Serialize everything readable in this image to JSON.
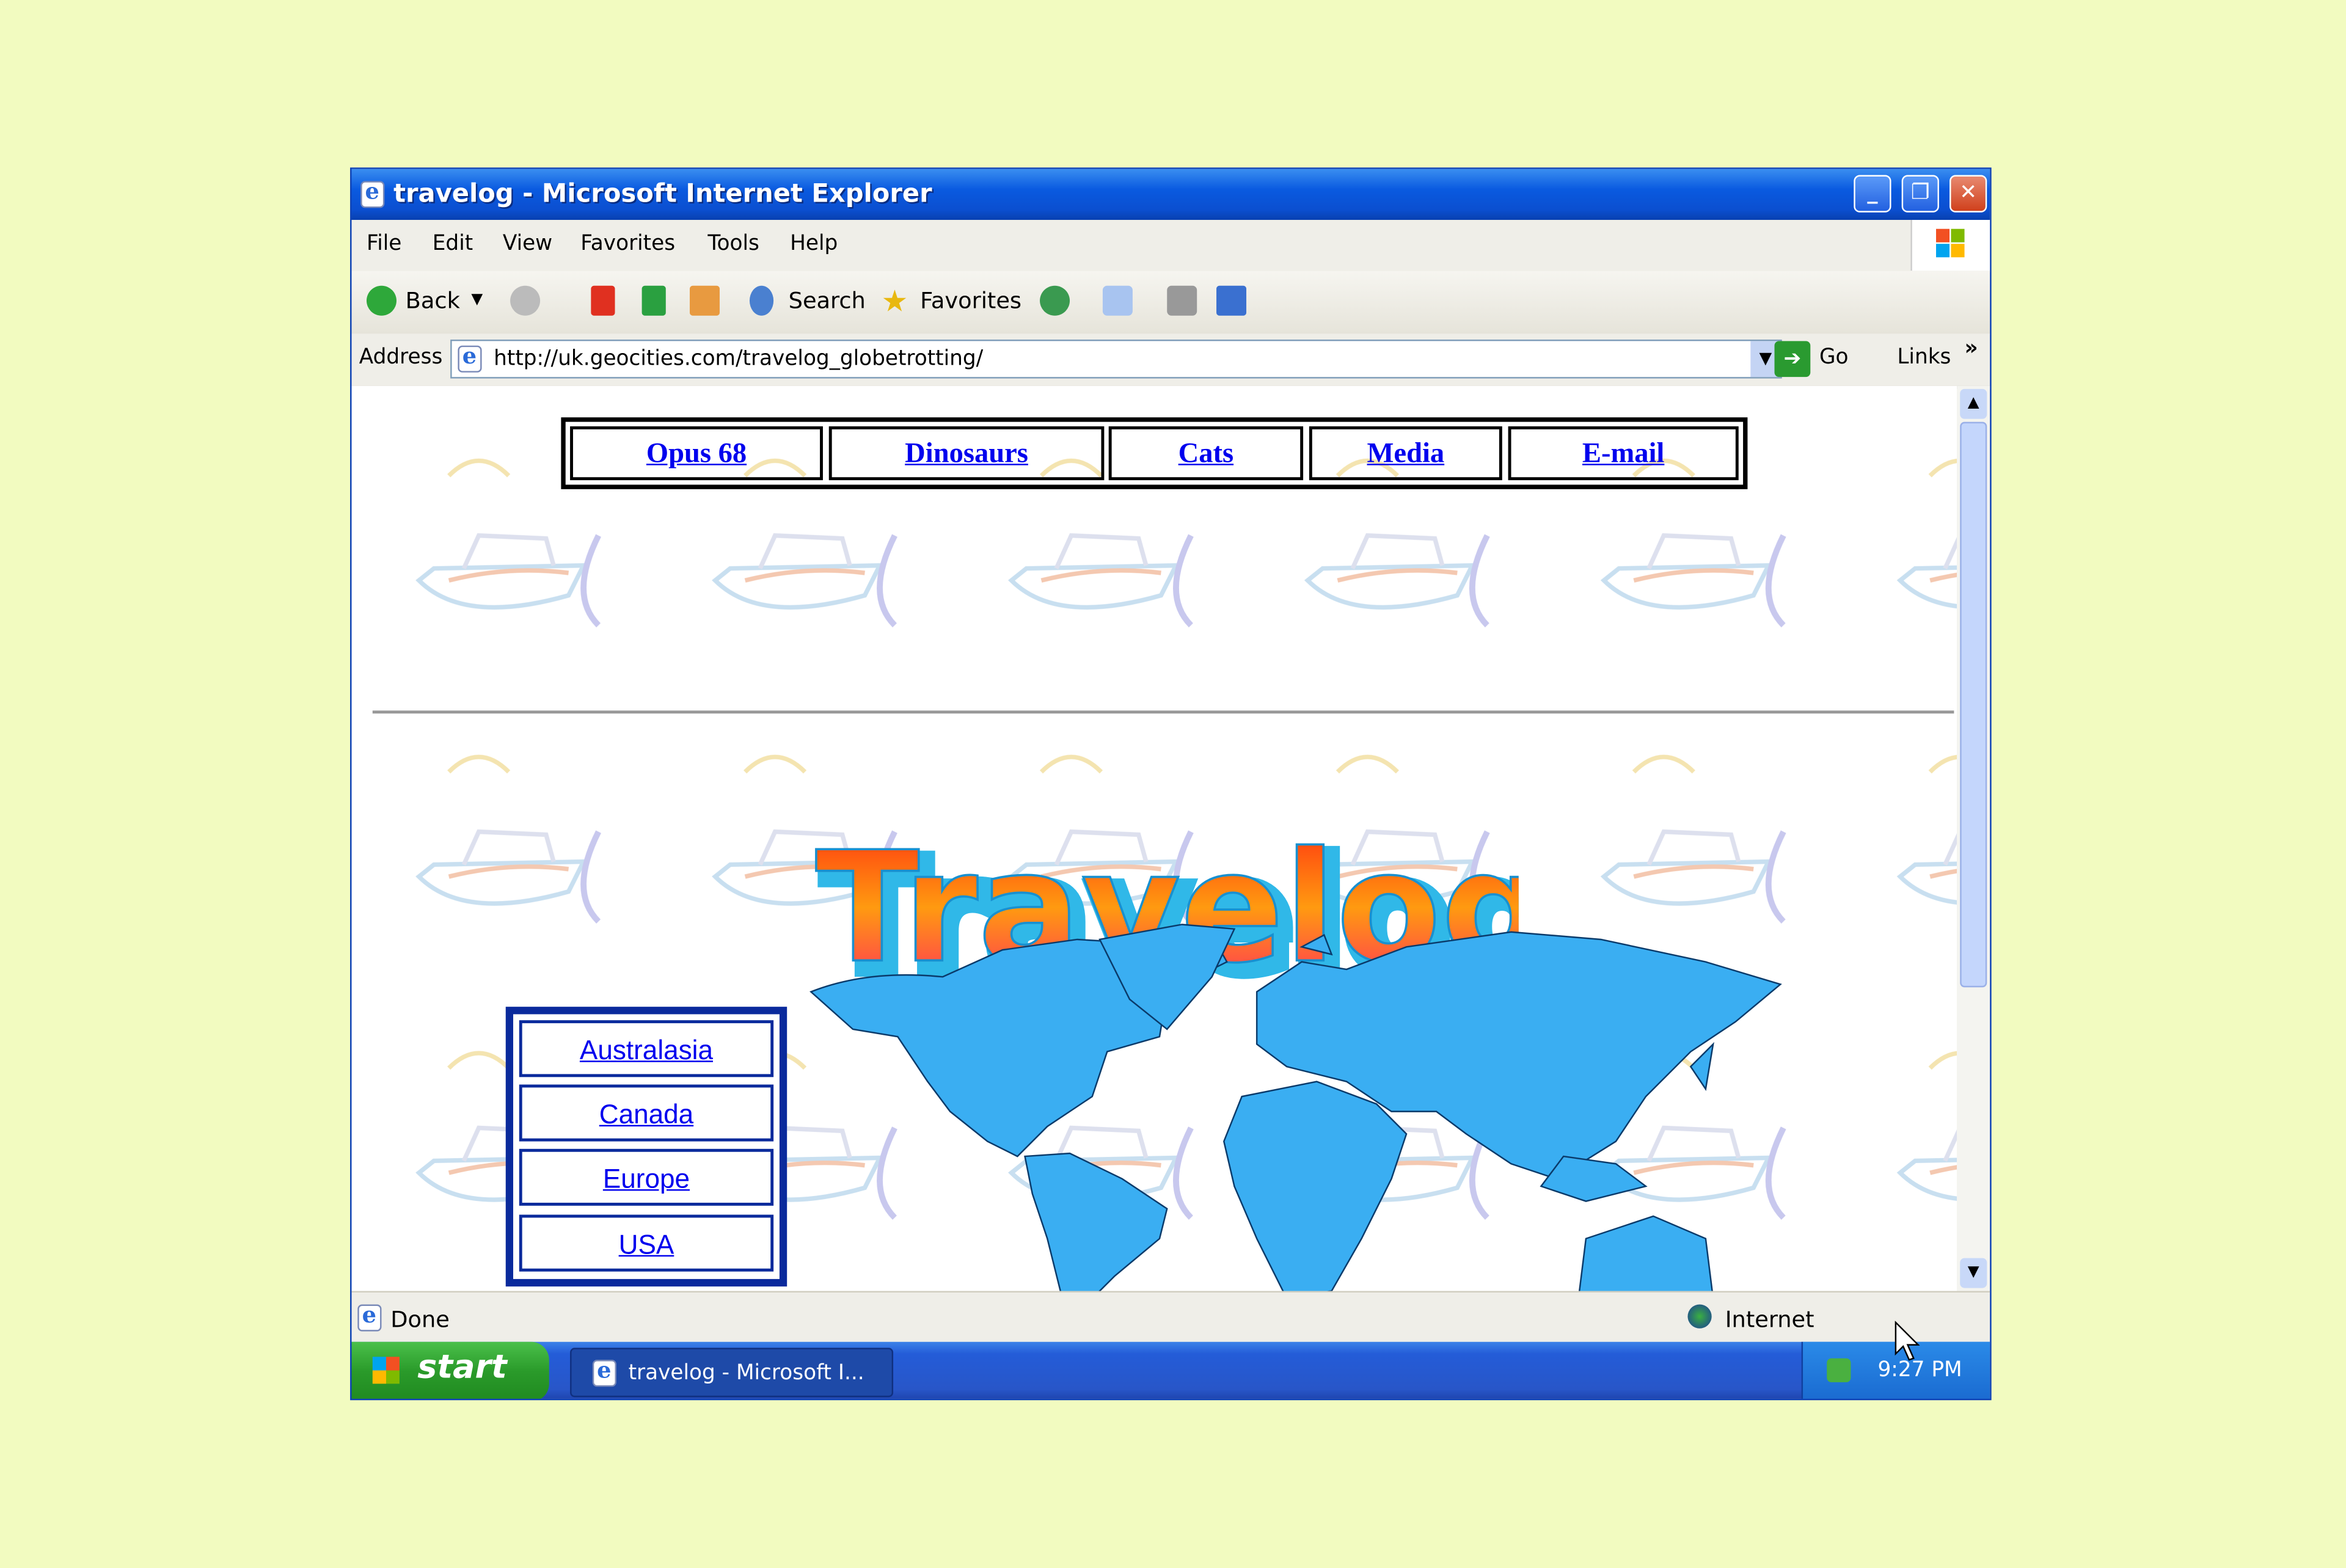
{
  "window": {
    "title": "travelog - Microsoft Internet Explorer"
  },
  "menu": [
    "File",
    "Edit",
    "View",
    "Favorites",
    "Tools",
    "Help"
  ],
  "toolbar": {
    "back": "Back",
    "search": "Search",
    "favorites": "Favorites"
  },
  "address": {
    "label": "Address",
    "url": "http://uk.geocities.com/travelog_globetrotting/",
    "go": "Go",
    "links": "Links",
    "more": "»"
  },
  "page": {
    "nav": [
      "Opus 68",
      "Dinosaurs",
      "Cats",
      "Media",
      "E-mail"
    ],
    "logo": "Travelog",
    "regions": [
      "Australasia",
      "Canada",
      "Europe",
      "USA"
    ],
    "colors": {
      "link": "#0000ee",
      "map": "#3aaef2",
      "box_border": "#0a2a9c"
    }
  },
  "status": {
    "text": "Done",
    "zone": "Internet"
  },
  "taskbar": {
    "start": "start",
    "task": "travelog - Microsoft I...",
    "clock": "9:27 PM"
  }
}
